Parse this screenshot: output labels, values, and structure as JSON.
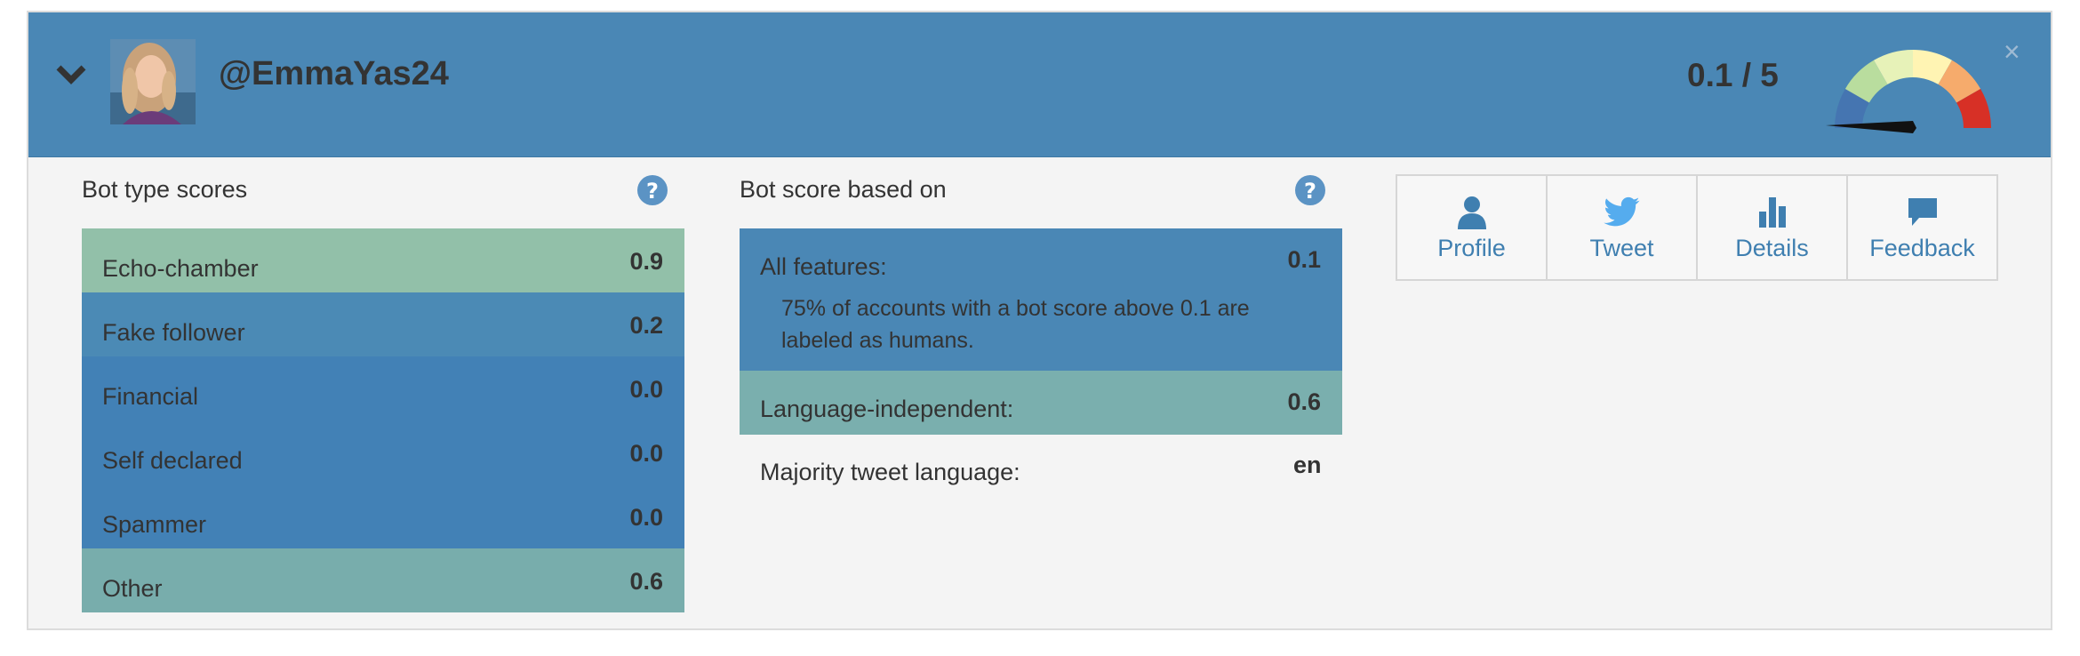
{
  "header": {
    "handle": "@EmmaYas24",
    "score": "0.1 / 5",
    "colors": {
      "bar": "#4a87b5"
    }
  },
  "bot_type": {
    "title": "Bot type scores",
    "items": [
      {
        "label": "Echo-chamber",
        "value": "0.9",
        "color": "#92c0a9"
      },
      {
        "label": "Fake follower",
        "value": "0.2",
        "color": "#4b8ab5"
      },
      {
        "label": "Financial",
        "value": "0.0",
        "color": "#4281b6"
      },
      {
        "label": "Self declared",
        "value": "0.0",
        "color": "#4281b6"
      },
      {
        "label": "Spammer",
        "value": "0.0",
        "color": "#4281b6"
      },
      {
        "label": "Other",
        "value": "0.6",
        "color": "#78adac"
      }
    ]
  },
  "bot_score": {
    "title": "Bot score based on",
    "all_features": {
      "label": "All features:",
      "value": "0.1",
      "description": "75% of accounts with a bot score above 0.1 are labeled as humans."
    },
    "language_independent": {
      "label": "Language-independent:",
      "value": "0.6"
    },
    "majority_language": {
      "label": "Majority tweet language:",
      "value": "en"
    }
  },
  "actions": [
    {
      "label": "Profile",
      "icon": "user-icon"
    },
    {
      "label": "Tweet",
      "icon": "twitter-bird-icon"
    },
    {
      "label": "Details",
      "icon": "bar-chart-icon"
    },
    {
      "label": "Feedback",
      "icon": "comment-icon"
    }
  ]
}
